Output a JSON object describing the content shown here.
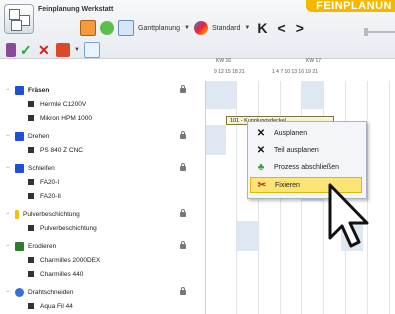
{
  "app": {
    "title": "Feinplanung Werkstatt",
    "badge": "FEINPLANUN"
  },
  "toolbar": {
    "view_dropdown": "Ganttplanung",
    "standard_dropdown": "Standard"
  },
  "nav": {
    "first": "K",
    "prev": "<",
    "next": ">"
  },
  "timeline": {
    "weeks": [
      "KW 16",
      "KW 17"
    ],
    "day_numbers_a": "9 12 15 18 21",
    "day_numbers_b": "1 4 7 10 13 16 19 21"
  },
  "tree": {
    "groups": [
      {
        "label": "Fräsen",
        "icon_color": "#1e4fd6",
        "children": [
          "Hermle C1200V",
          "Mikron HPM 1000"
        ]
      },
      {
        "label": "Drehen",
        "icon_color": "#1e4fd6",
        "children": [
          "PS 840 Z CNC"
        ]
      },
      {
        "label": "Schleifen",
        "icon_color": "#1e4fd6",
        "children": [
          "FA20-I",
          "FA20-II"
        ]
      },
      {
        "label": "Pulverbeschichtung",
        "icon_color": "#f2c200",
        "children": [
          "Pulverbeschichtung"
        ]
      },
      {
        "label": "Erodieren",
        "icon_color": "#2f7a2f",
        "children": [
          "Charmilles 2000DEX",
          "Charmilles 440"
        ]
      },
      {
        "label": "Drahtschneiden",
        "icon_color": "#3a6fd8",
        "children": [
          "Aqua Fil 44"
        ]
      }
    ]
  },
  "gantt": {
    "bar_label": "101 - Kupplungsdeckel"
  },
  "context_menu": {
    "items": [
      {
        "icon": "x-icon",
        "label": "Ausplanen"
      },
      {
        "icon": "x-icon",
        "label": "Teil ausplanen"
      },
      {
        "icon": "flow-icon",
        "label": "Prozess abschließen"
      },
      {
        "icon": "scissors-icon",
        "label": "Fixieren"
      }
    ],
    "selected_index": 3
  }
}
